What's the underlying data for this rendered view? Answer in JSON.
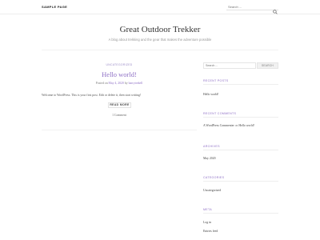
{
  "nav": {
    "sample_page": "SAMPLE PAGE"
  },
  "top_search": {
    "placeholder": "Search ..."
  },
  "site": {
    "title": "Great Outdoor Trekker",
    "description": "A blog about trekking and the gear that makes the adventure possible"
  },
  "post": {
    "category": "UNCATEGORIZED",
    "title": "Hello world!",
    "meta_prefix": "Posted on",
    "date": "May 4, 2020",
    "meta_by": "by",
    "author": "barrytrekell",
    "excerpt": "Welcome to WordPress. This is your first post. Edit or delete it, then start writing!",
    "read_more": "READ MORE",
    "comments": "1 Comment"
  },
  "sidebar": {
    "search_placeholder": "Search ...",
    "search_button": "SEARCH",
    "recent_posts": {
      "title": "RECENT POSTS",
      "items": [
        "Hello world!"
      ]
    },
    "recent_comments": {
      "title": "RECENT COMMENTS",
      "author": "A WordPress Commenter",
      "on": "on",
      "post": "Hello world!"
    },
    "archives": {
      "title": "ARCHIVES",
      "items": [
        "May 2020"
      ]
    },
    "categories": {
      "title": "CATEGORIES",
      "items": [
        "Uncategorized"
      ]
    },
    "meta": {
      "title": "META",
      "items": [
        "Log in",
        "Entries feed"
      ]
    }
  },
  "colors": {
    "accent": "#8e6fc5",
    "text": "#333333",
    "muted": "#999999"
  }
}
